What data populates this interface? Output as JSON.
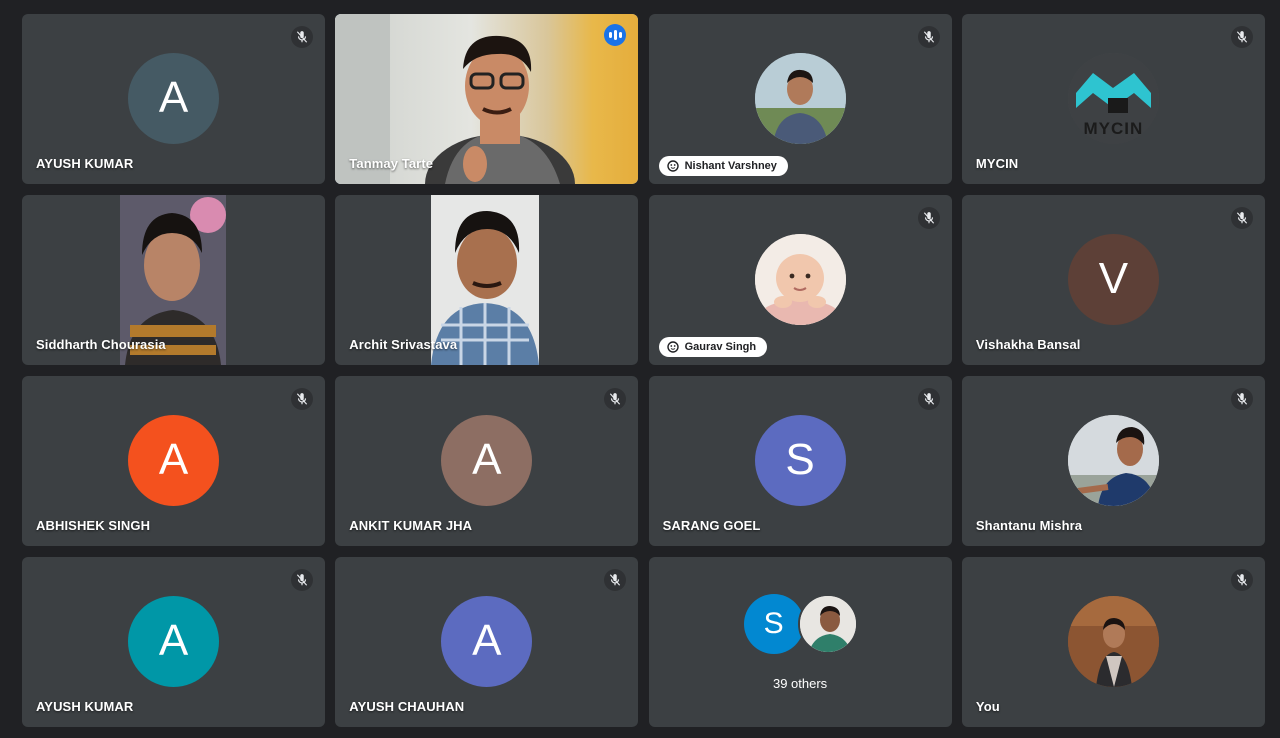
{
  "participants": [
    {
      "name": "AYUSH KUMAR",
      "initial": "A",
      "color": "#455a64",
      "muted": true
    },
    {
      "name": "Tanmay Tarte",
      "video": true,
      "speaking": true
    },
    {
      "name": "Nishant Varshney",
      "photo": true,
      "muted": true
    },
    {
      "name": "MYCIN",
      "logo": true,
      "logo_text": "MYCIN",
      "muted": true
    },
    {
      "name": "Siddharth Chourasia",
      "video": true
    },
    {
      "name": "Archit Srivastava",
      "video": true
    },
    {
      "name": "Gaurav Singh",
      "photo": true,
      "muted": true
    },
    {
      "name": "Vishakha Bansal",
      "initial": "V",
      "color": "#5d4037",
      "muted": true
    },
    {
      "name": "ABHISHEK SINGH",
      "initial": "A",
      "color": "#f4511e",
      "muted": true
    },
    {
      "name": "ANKIT KUMAR JHA",
      "initial": "A",
      "color": "#8d6e63",
      "muted": true
    },
    {
      "name": "SARANG GOEL",
      "initial": "S",
      "color": "#5c6bc0",
      "muted": true
    },
    {
      "name": "Shantanu Mishra",
      "photo": true,
      "muted": true
    },
    {
      "name": "AYUSH KUMAR",
      "initial": "A",
      "color": "#0097a7",
      "muted": true
    },
    {
      "name": "AYUSH CHAUHAN",
      "initial": "A",
      "color": "#5c6bc0",
      "muted": true
    },
    {
      "name": "",
      "others": true
    },
    {
      "name": "You",
      "photo": true,
      "muted": true
    }
  ],
  "others": {
    "label": "39 others",
    "avatar_initial": "S",
    "avatar_color": "#0288d1"
  },
  "icons": {
    "muted": "mic-off-icon",
    "speaking": "audio-level-icon"
  }
}
